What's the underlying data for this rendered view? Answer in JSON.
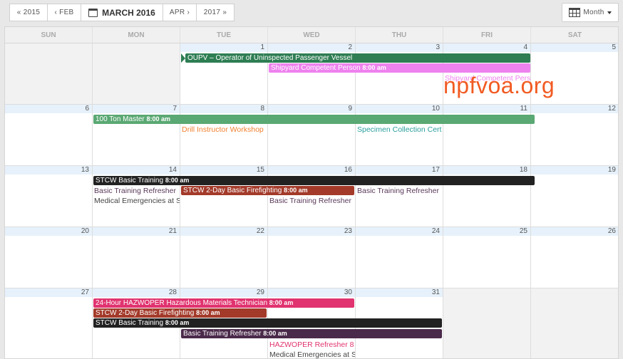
{
  "toolbar": {
    "prev_year": "« 2015",
    "prev_month": "‹ FEB",
    "current_month": "MARCH 2016",
    "next_month": "APR ›",
    "next_year": "2017 »",
    "view_label": "Month"
  },
  "icons": {
    "calendar": "calendar-icon",
    "view": "calendar-grid-icon",
    "caret": "caret-down-icon"
  },
  "weekdays": [
    "SUN",
    "MON",
    "TUE",
    "WED",
    "THU",
    "FRI",
    "SAT"
  ],
  "weeks": [
    {
      "days": [
        "",
        "",
        "1",
        "2",
        "3",
        "4",
        "5"
      ]
    },
    {
      "days": [
        "6",
        "7",
        "8",
        "9",
        "10",
        "11",
        "12"
      ]
    },
    {
      "days": [
        "13",
        "14",
        "15",
        "16",
        "17",
        "18",
        "19"
      ]
    },
    {
      "days": [
        "20",
        "21",
        "22",
        "23",
        "24",
        "25",
        "26"
      ]
    },
    {
      "days": [
        "27",
        "28",
        "29",
        "30",
        "31",
        "",
        ""
      ]
    }
  ],
  "events": {
    "e1": {
      "title": "OUPV – Operator of Uninspected Passenger Vessel",
      "time": "",
      "color": "#2e7d53"
    },
    "e2": {
      "title": "Shipyard Competent Person",
      "time": "8:00 am",
      "color": "#ee82ee"
    },
    "e3": {
      "title": "Shipyard Competent Pers",
      "color": "#ee82ee"
    },
    "e4": {
      "title": "100 Ton Master",
      "time": "8:00 am",
      "color": "#5aa873"
    },
    "e5": {
      "title": "Drill Instructor Workshop",
      "color": "#f08030"
    },
    "e6": {
      "title": "Specimen Collection Cert",
      "color": "#2a9d9d"
    },
    "e7": {
      "title": "STCW Basic Training",
      "time": "8:00 am",
      "color": "#222222"
    },
    "e8": {
      "title": "Basic Training Refresher",
      "color": "#5a3a5a"
    },
    "e9": {
      "title": "STCW 2-Day Basic Firefighting",
      "time": "8:00 am",
      "color": "#a33a2a"
    },
    "e10": {
      "title": "Basic Training Refresher",
      "color": "#5a3a5a"
    },
    "e11": {
      "title": "Medical Emergencies at S",
      "color": "#444444"
    },
    "e12": {
      "title": "Basic Training Refresher",
      "color": "#5a3a5a"
    },
    "e13": {
      "title": "24-Hour HAZWOPER Hazardous Materials Technician",
      "time": "8:00 am",
      "color": "#e0336f"
    },
    "e14": {
      "title": "STCW 2-Day Basic Firefighting",
      "time": "8:00 am",
      "color": "#a33a2a"
    },
    "e15": {
      "title": "STCW Basic Training",
      "time": "8:00 am",
      "color": "#222222"
    },
    "e16": {
      "title": "Basic Training Refresher",
      "time": "8:00 am",
      "color": "#4a2a4a"
    },
    "e17": {
      "title": "HAZWOPER Refresher 8",
      "color": "#e0336f"
    },
    "e18": {
      "title": "Medical Emergencies at S",
      "color": "#444444"
    }
  },
  "watermark": "npfvoa.org"
}
